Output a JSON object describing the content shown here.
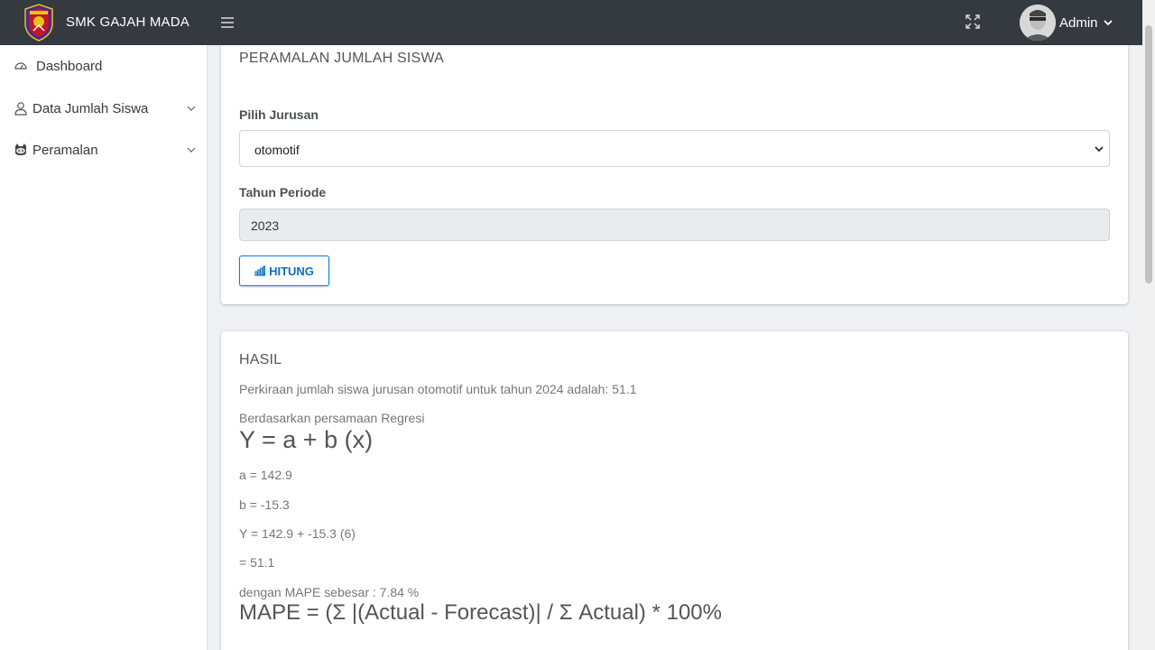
{
  "header": {
    "brand": "SMK GAJAH MADA",
    "user_name": "Admin",
    "icons": [
      "school-logo",
      "hamburger-icon",
      "fullscreen-icon",
      "avatar",
      "chevron-down-icon"
    ]
  },
  "sidebar": {
    "items": [
      {
        "label": "Dashboard",
        "icon": "dashboard-icon"
      },
      {
        "label": "Data Jumlah Siswa",
        "icon": "user-icon"
      },
      {
        "label": "Peramalan",
        "icon": "github-icon"
      }
    ]
  },
  "form": {
    "title": "PERAMALAN JUMLAH SISWA",
    "jurusan_label": "Pilih Jurusan",
    "jurusan_value": "otomotif",
    "tahun_label": "Tahun Periode",
    "tahun_value": "2023",
    "button_label": "HITUNG"
  },
  "result": {
    "title": "HASIL",
    "summary": "Perkiraan jumlah siswa jurusan otomotif untuk tahun 2024 adalah: 51.1",
    "regression_intro": "Berdasarkan persamaan Regresi",
    "equation": "Y = a + b (x)",
    "a_line": "a = 142.9",
    "b_line": "b = -15.3",
    "y_line": "Y = 142.9 + -15.3 (6)",
    "eq_line": "= 51.1",
    "mape_line": "dengan MAPE sebesar : 7.84 %",
    "mape_formula": "MAPE = (Σ |(Actual - Forecast)| / Σ Actual) * 100%"
  },
  "colors": {
    "topbar": "#343a40",
    "accent": "#007bff",
    "background": "#eef0f3"
  }
}
